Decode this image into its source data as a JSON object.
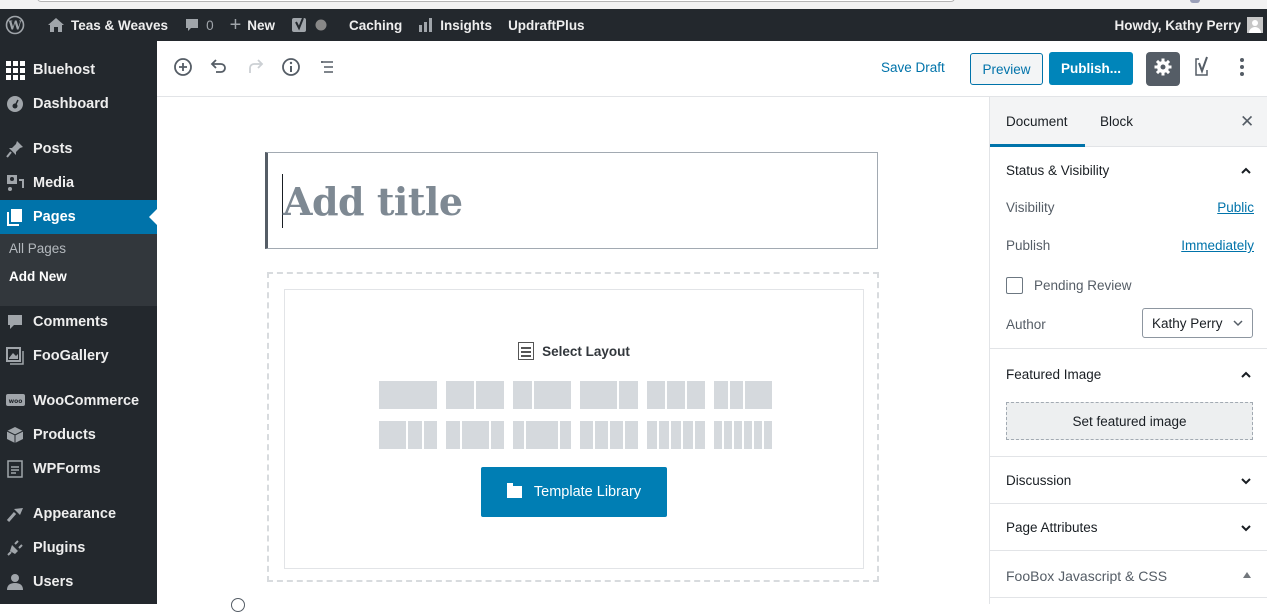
{
  "admin_bar": {
    "site_name": "Teas & Weaves",
    "comments_count": "0",
    "new_label": "New",
    "caching_label": "Caching",
    "insights_label": "Insights",
    "updraft_label": "UpdraftPlus",
    "greeting": "Howdy, Kathy Perry"
  },
  "sidebar": {
    "items": [
      {
        "label": "Bluehost",
        "icon": "grid-icon"
      },
      {
        "label": "Dashboard",
        "icon": "dashboard-icon"
      },
      {
        "label": "Posts",
        "icon": "pin-icon"
      },
      {
        "label": "Media",
        "icon": "media-icon"
      },
      {
        "label": "Pages",
        "icon": "pages-icon",
        "active": true
      },
      {
        "label": "Comments",
        "icon": "comment-icon"
      },
      {
        "label": "FooGallery",
        "icon": "gallery-icon"
      },
      {
        "label": "WooCommerce",
        "icon": "woo-icon"
      },
      {
        "label": "Products",
        "icon": "box-icon"
      },
      {
        "label": "WPForms",
        "icon": "forms-icon"
      },
      {
        "label": "Appearance",
        "icon": "brush-icon"
      },
      {
        "label": "Plugins",
        "icon": "plug-icon"
      },
      {
        "label": "Users",
        "icon": "user-icon"
      }
    ],
    "submenu": [
      {
        "label": "All Pages"
      },
      {
        "label": "Add New",
        "current": true
      }
    ]
  },
  "toolbar": {
    "save_draft": "Save Draft",
    "preview": "Preview",
    "publish": "Publish..."
  },
  "editor": {
    "title_placeholder": "Add title",
    "select_layout": "Select Layout",
    "layouts_row1": [
      [
        1
      ],
      [
        1,
        1
      ],
      [
        1,
        2
      ],
      [
        2,
        1
      ],
      [
        1,
        1,
        1
      ],
      [
        1,
        1,
        2
      ]
    ],
    "layouts_row2": [
      [
        2,
        1,
        1
      ],
      [
        1,
        2,
        1
      ],
      [
        1,
        3,
        1
      ],
      [
        1,
        1,
        1,
        1
      ],
      [
        1,
        1,
        1,
        1,
        1
      ],
      [
        1,
        1,
        1,
        1,
        1,
        1
      ]
    ],
    "template_library": "Template Library"
  },
  "panel": {
    "tabs": [
      {
        "label": "Document",
        "active": true
      },
      {
        "label": "Block"
      }
    ],
    "status_visibility": {
      "title": "Status & Visibility",
      "visibility_label": "Visibility",
      "visibility_value": "Public",
      "publish_label": "Publish",
      "publish_value": "Immediately",
      "pending_review": "Pending Review",
      "pending_checked": false,
      "author_label": "Author",
      "author_value": "Kathy Perry"
    },
    "featured_image": {
      "title": "Featured Image",
      "button": "Set featured image"
    },
    "discussion": "Discussion",
    "page_attributes": "Page Attributes",
    "foobox": "FooBox Javascript & CSS"
  },
  "colors": {
    "accent": "#0073aa",
    "publish": "#0085ba",
    "admin_bar": "#23282d"
  }
}
